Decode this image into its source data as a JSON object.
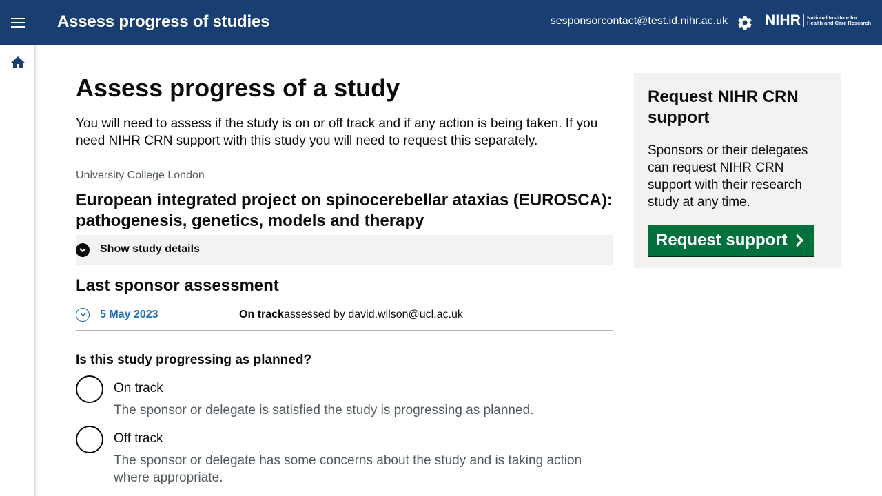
{
  "header": {
    "app_title": "Assess progress of studies",
    "user_email": "sesponsorcontact@test.id.nihr.ac.uk",
    "logo_mark": "NIHR",
    "logo_text_line1": "National Institute for",
    "logo_text_line2": "Health and Care Research",
    "menu_icon": "menu-icon",
    "settings_icon": "gear-icon",
    "background_color": "#193e72"
  },
  "sidebar": {
    "home_icon": "home-icon"
  },
  "main": {
    "page_title": "Assess progress of a study",
    "lead": "You will need to assess if the study is on or off track and if any action is being taken. If you need NIHR CRN support with this study you will need to request this separately.",
    "organisation": "University College London",
    "study_title": "European integrated project on spinocerebellar ataxias (EUROSCA): pathogenesis, genetics, models and therapy",
    "show_details_label": "Show study details",
    "last_assessment": {
      "heading": "Last sponsor assessment",
      "date": "5 May 2023",
      "status": "On track",
      "assessed_by": "assessed by david.wilson@ucl.ac.uk"
    },
    "question": "Is this study progressing as planned?",
    "options": [
      {
        "label": "On track",
        "hint": "The sponsor or delegate is satisfied the study is progressing as planned."
      },
      {
        "label": "Off track",
        "hint": "The sponsor or delegate has some concerns about the study and is taking action where appropriate."
      }
    ]
  },
  "aside": {
    "title": "Request NIHR CRN support",
    "body": "Sponsors or their delegates can request NIHR CRN support with their research study at any time.",
    "button_label": "Request support",
    "button_color": "#00703c"
  }
}
